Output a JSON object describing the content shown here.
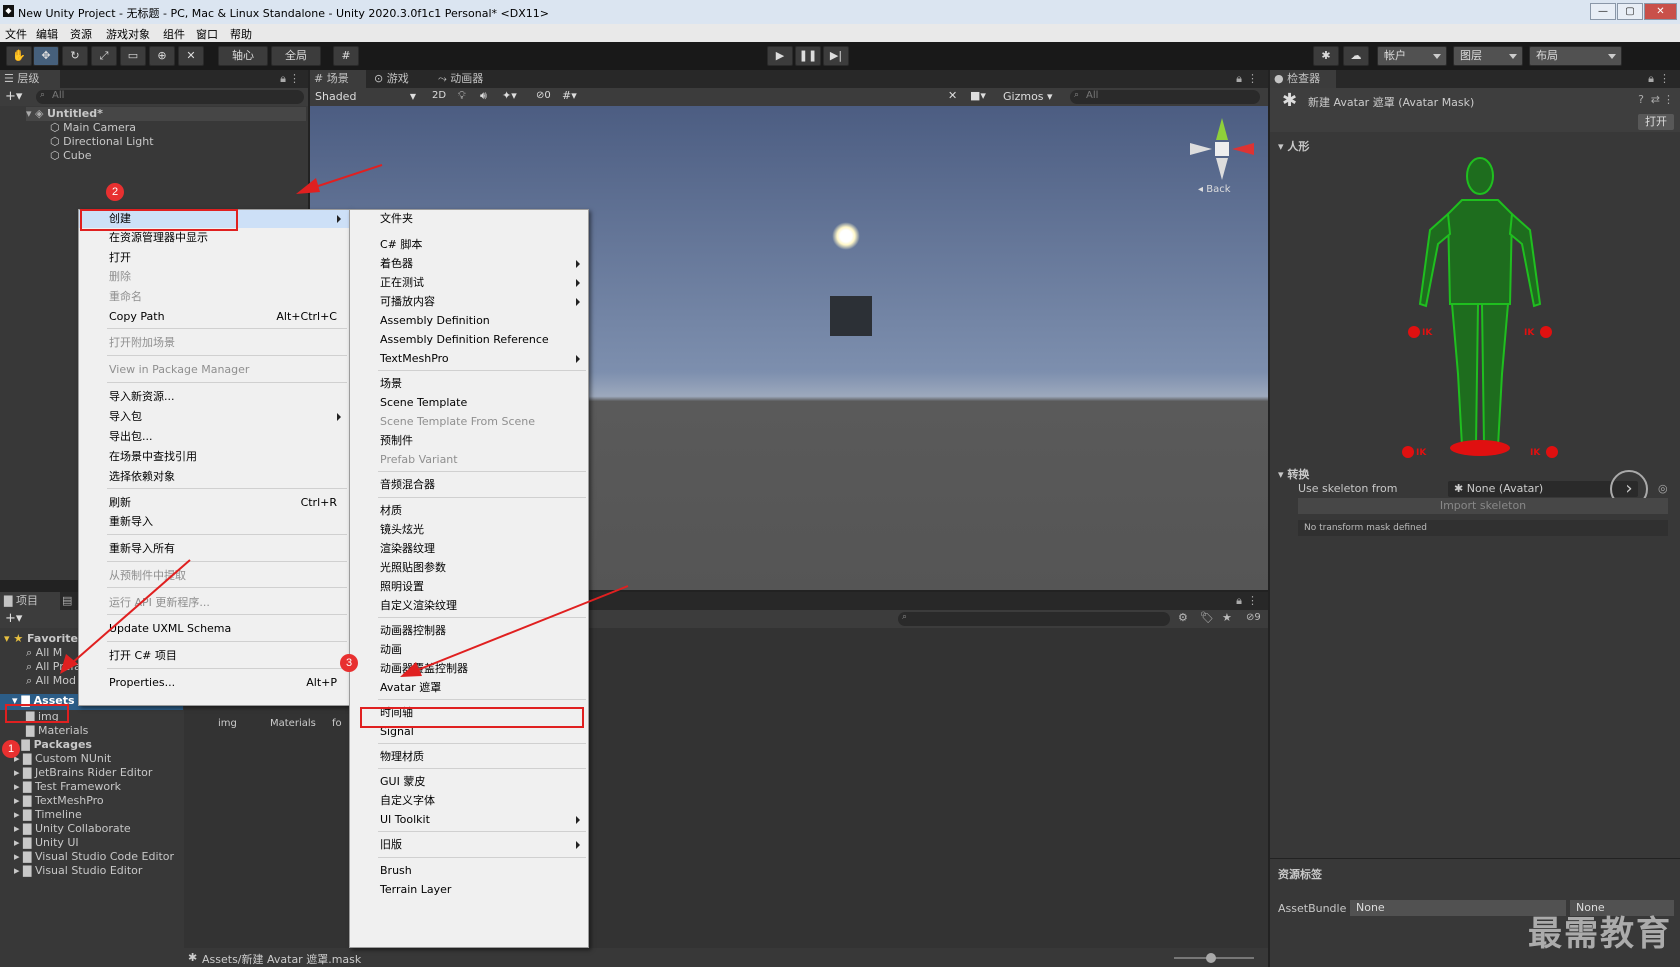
{
  "window": {
    "title": "New Unity Project - 无标题 - PC, Mac & Linux Standalone - Unity 2020.3.0f1c1 Personal* <DX11>"
  },
  "menubar": [
    "文件",
    "编辑",
    "资源",
    "游戏对象",
    "组件",
    "窗口",
    "帮助"
  ],
  "toolbar": {
    "pivot": "轴心",
    "global": "全局",
    "account": "帐户",
    "layers": "图层",
    "layout": "布局"
  },
  "hierarchy": {
    "tab": "层级",
    "search_placeholder": "All",
    "scene": "Untitled*",
    "items": [
      "Main Camera",
      "Directional Light",
      "Cube"
    ]
  },
  "scene_view": {
    "tabs": [
      "场景",
      "游戏",
      "动画器"
    ],
    "shading": "Shaded",
    "mode_2d": "2D",
    "hidden_count": "0",
    "gizmos": "Gizmos",
    "search_placeholder": "All",
    "gizmo_label": "Back"
  },
  "context_menu": {
    "items": [
      {
        "label": "创建",
        "disabled": false,
        "arrow": true
      },
      {
        "label": "在资源管理器中显示",
        "disabled": false
      },
      {
        "label": "打开",
        "disabled": false
      },
      {
        "label": "删除",
        "disabled": true
      },
      {
        "label": "重命名",
        "disabled": true
      },
      {
        "label": "Copy Path",
        "shortcut": "Alt+Ctrl+C",
        "disabled": false
      },
      {
        "label": "打开附加场景",
        "disabled": true
      },
      {
        "label": "View in Package Manager",
        "disabled": true
      },
      {
        "label": "导入新资源...",
        "disabled": false
      },
      {
        "label": "导入包",
        "disabled": false,
        "arrow": true
      },
      {
        "label": "导出包...",
        "disabled": false
      },
      {
        "label": "在场景中查找引用",
        "disabled": false
      },
      {
        "label": "选择依赖对象",
        "disabled": false
      },
      {
        "label": "刷新",
        "shortcut": "Ctrl+R",
        "disabled": false
      },
      {
        "label": "重新导入",
        "disabled": false
      },
      {
        "label": "重新导入所有",
        "disabled": false
      },
      {
        "label": "从预制件中提取",
        "disabled": true
      },
      {
        "label": "运行 API 更新程序...",
        "disabled": true
      },
      {
        "label": "Update UXML Schema",
        "disabled": false
      },
      {
        "label": "打开 C# 项目",
        "disabled": false
      },
      {
        "label": "Properties...",
        "shortcut": "Alt+P",
        "disabled": false
      }
    ]
  },
  "create_submenu": {
    "items": [
      {
        "label": "文件夹"
      },
      {
        "label": "C# 脚本"
      },
      {
        "label": "着色器",
        "arrow": true
      },
      {
        "label": "正在测试",
        "arrow": true
      },
      {
        "label": "可播放内容",
        "arrow": true
      },
      {
        "label": "Assembly Definition"
      },
      {
        "label": "Assembly Definition Reference"
      },
      {
        "label": "TextMeshPro",
        "arrow": true
      },
      {
        "label": "场景"
      },
      {
        "label": "Scene Template"
      },
      {
        "label": "Scene Template From Scene",
        "disabled": true
      },
      {
        "label": "预制件"
      },
      {
        "label": "Prefab Variant",
        "disabled": true
      },
      {
        "label": "音频混合器"
      },
      {
        "label": "材质"
      },
      {
        "label": "镜头炫光"
      },
      {
        "label": "渲染器纹理"
      },
      {
        "label": "光照贴图参数"
      },
      {
        "label": "照明设置"
      },
      {
        "label": "自定义渲染纹理"
      },
      {
        "label": "动画器控制器"
      },
      {
        "label": "动画"
      },
      {
        "label": "动画器覆盖控制器"
      },
      {
        "label": "Avatar 遮罩"
      },
      {
        "label": "时间轴"
      },
      {
        "label": "Signal"
      },
      {
        "label": "物理材质"
      },
      {
        "label": "GUI 蒙皮"
      },
      {
        "label": "自定义字体"
      },
      {
        "label": "UI Toolkit",
        "arrow": true
      },
      {
        "label": "旧版",
        "arrow": true
      },
      {
        "label": "Brush"
      },
      {
        "label": "Terrain Layer"
      }
    ]
  },
  "project": {
    "tab": "项目",
    "favorites": "Favorites",
    "fav_items": [
      "All M",
      "All Prefa",
      "All Mod"
    ],
    "assets": "Assets",
    "asset_children": [
      "img",
      "Materials"
    ],
    "packages": "Packages",
    "package_items": [
      "Custom NUnit",
      "JetBrains Rider Editor",
      "Test Framework",
      "TextMeshPro",
      "Timeline",
      "Unity Collaborate",
      "Unity UI",
      "Visual Studio Code Editor",
      "Visual Studio Editor"
    ],
    "grid_items": [
      "img",
      "Materials",
      "fo"
    ],
    "hidden_count": "9",
    "status_path": "Assets/新建 Avatar 遮罩.mask"
  },
  "inspector": {
    "tab": "检查器",
    "title": "新建 Avatar 遮罩 (Avatar Mask)",
    "open_button": "打开",
    "humanoid": "人形",
    "ik_label": "IK",
    "transform": "转换",
    "skeleton_label": "Use skeleton from",
    "skeleton_value": "None (Avatar)",
    "import_button": "Import skeleton",
    "no_mask": "No transform mask defined",
    "asset_labels": "资源标签",
    "assetbundle_label": "AssetBundle",
    "assetbundle_value": "None",
    "variant_value": "None"
  },
  "annotations": {
    "badges": [
      "1",
      "2",
      "3"
    ]
  },
  "watermark": "最需教育",
  "colors": {
    "scene_sky_top": "#4c5d82",
    "scene_ground": "#5a5a5a",
    "highlight": "#e02020",
    "selection": "#2c5d87",
    "avatar_green": "#1fbf1f"
  }
}
